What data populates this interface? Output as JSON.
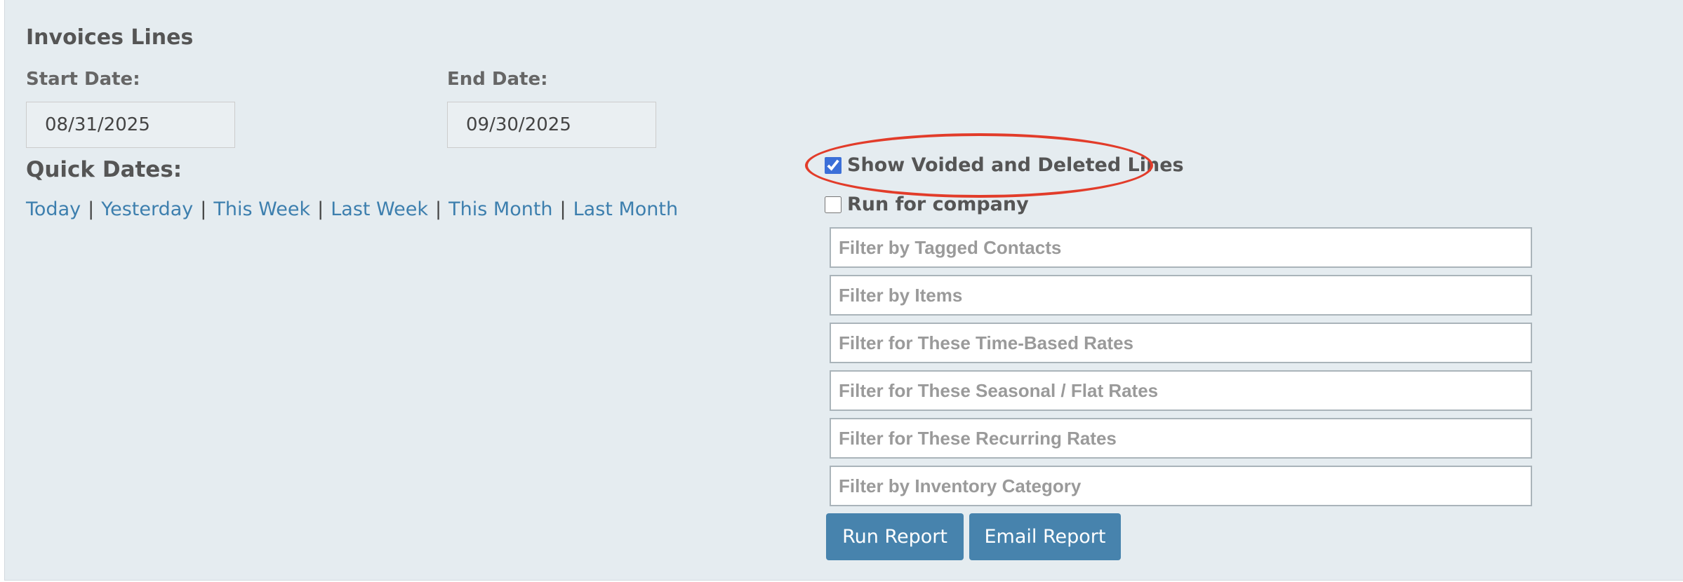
{
  "report": {
    "title": "Invoices Lines",
    "start_date_label": "Start Date:",
    "start_date_value": "08/31/2025",
    "end_date_label": "End Date:",
    "end_date_value": "09/30/2025"
  },
  "quick_dates": {
    "label": "Quick Dates:",
    "links": [
      "Today",
      "Yesterday",
      "This Week",
      "Last Week",
      "This Month",
      "Last Month"
    ],
    "separator": "|"
  },
  "options": {
    "show_voided": {
      "label": "Show Voided and Deleted Lines",
      "checked": true
    },
    "run_for_company": {
      "label": "Run for company",
      "checked": false
    }
  },
  "filters": [
    {
      "placeholder": "Filter by Tagged Contacts"
    },
    {
      "placeholder": "Filter by Items"
    },
    {
      "placeholder": "Filter for These Time-Based Rates"
    },
    {
      "placeholder": "Filter for These Seasonal / Flat Rates"
    },
    {
      "placeholder": "Filter for These Recurring Rates"
    },
    {
      "placeholder": "Filter by Inventory Category"
    }
  ],
  "actions": {
    "run_report": "Run Report",
    "email_report": "Email Report"
  },
  "colors": {
    "panel_background": "#e5ecf0",
    "link": "#3d7fae",
    "button": "#4783ad",
    "highlight": "#e23c2a"
  }
}
